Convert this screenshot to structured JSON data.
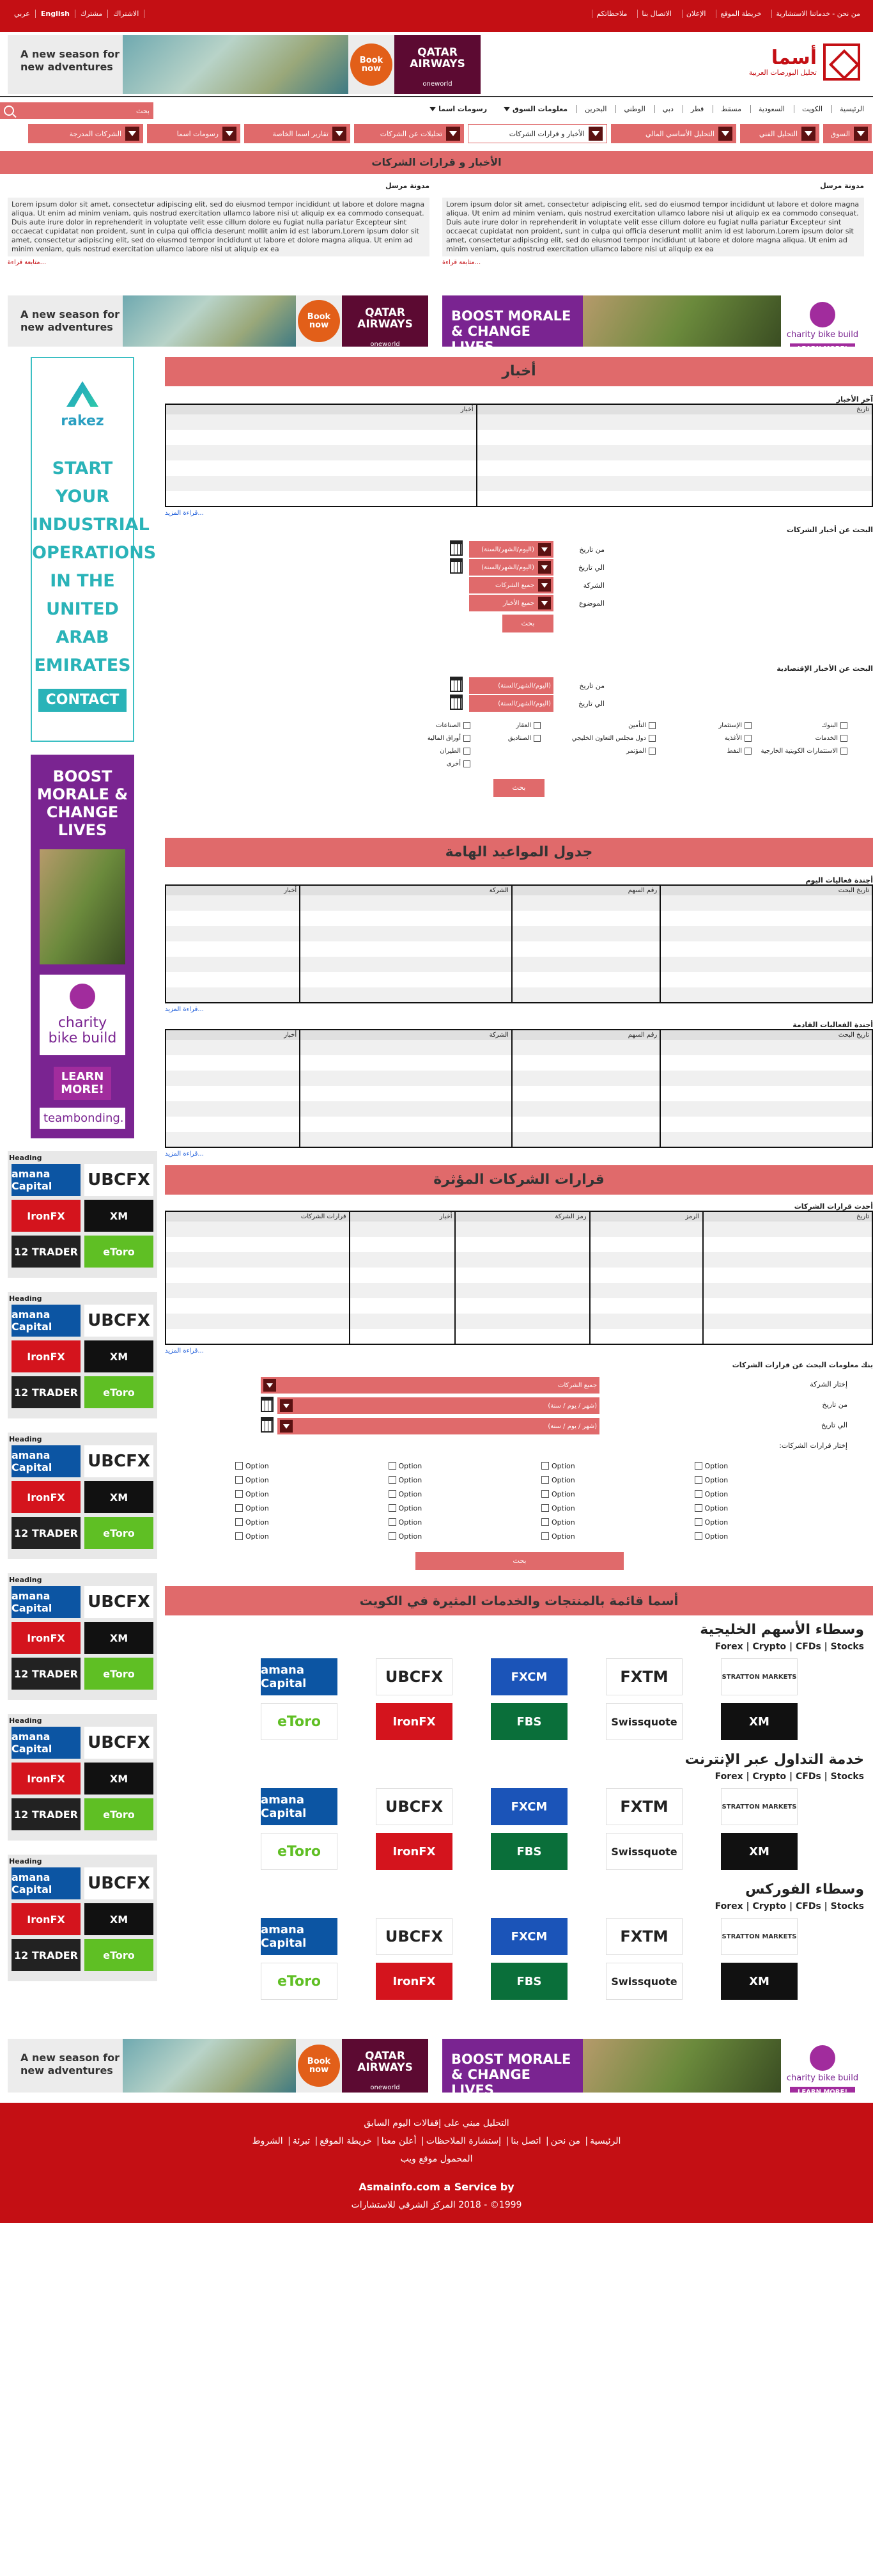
{
  "topbar": {
    "links": [
      "من نحن - خدماتنا الاستشارية",
      "خريطة الموقع",
      "الإعلان",
      "الاتصال بنا",
      "ملاحظاتكم"
    ],
    "lang": [
      "الاشتراك",
      "مشترك",
      "English",
      "عربي"
    ]
  },
  "logo": {
    "title": "أسما",
    "subtitle": "تحليل البورصات العربية"
  },
  "ads": {
    "qatar_text": "A new season for new adventures",
    "qatar_book": "Book now",
    "qatar_brand": "QATAR AIRWAYS",
    "qatar_tag": "oneworld",
    "boost": "BOOST MORALE & CHANGE LIVES",
    "charity": "charity bike build",
    "learn_more": "LEARN MORE!",
    "teambonding": "teambonding.",
    "rakez_name": "rakez",
    "rakez_text": "START YOUR INDUSTRIAL OPERATIONS IN THE UNITED ARAB EMIRATES",
    "rakez_button": "CONTACT US"
  },
  "nav": {
    "items": [
      "الرئيسية",
      "الكويت",
      "السعودية",
      "مسقط",
      "قطر",
      "دبي",
      "الوطني",
      "البحرين"
    ],
    "market_info": "معلومات السوق",
    "asma_charts": "رسومات اسما",
    "search_placeholder": "بحث"
  },
  "catnav": [
    "السوق",
    "التحليل الفني",
    "التحليل الأساسي المالي",
    "الأخبار و قرارات الشركات",
    "تحليلات عن الشركات",
    "تقارير اسما الخاصة",
    "رسومات اسما",
    "الشركات المدرجة"
  ],
  "page_title": "الأخبار و قرارات الشركات",
  "blogs": [
    {
      "title": "مدونة مرسل",
      "text": "Lorem ipsum dolor sit amet, consectetur adipiscing elit, sed do eiusmod tempor incididunt ut labore et dolore magna aliqua. Ut enim ad minim veniam, quis nostrud exercitation ullamco labore nisi ut aliquip ex ea commodo consequat. Duis aute irure dolor in reprehenderit in voluptate velit esse cillum dolore eu fugiat nulla pariatur Excepteur sint occaecat cupidatat non proident, sunt in culpa qui officia deserunt mollit anim id est laborum.Lorem ipsum dolor sit amet, consectetur adipiscing elit, sed do eiusmod tempor incididunt ut labore et dolore magna aliqua. Ut enim ad minim veniam, quis nostrud exercitation ullamco labore nisi ut aliquip ex ea",
      "more": "متابعة قراءة..."
    },
    {
      "title": "مدونة مرسل",
      "text": "Lorem ipsum dolor sit amet, consectetur adipiscing elit, sed do eiusmod tempor incididunt ut labore et dolore magna aliqua. Ut enim ad minim veniam, quis nostrud exercitation ullamco labore nisi ut aliquip ex ea commodo consequat. Duis aute irure dolor in reprehenderit in voluptate velit esse cillum dolore eu fugiat nulla pariatur Excepteur sint occaecat cupidatat non proident, sunt in culpa qui officia deserunt mollit anim id est laborum.Lorem ipsum dolor sit amet, consectetur adipiscing elit, sed do eiusmod tempor incididunt ut labore et dolore magna aliqua. Ut enim ad minim veniam, quis nostrud exercitation ullamco labore nisi ut aliquip ex ea",
      "more": "متابعة قراءة..."
    }
  ],
  "news": {
    "heading": "أخبار",
    "latest": "آخر الأخبار",
    "cols": [
      "تاريخ",
      "أخبار"
    ],
    "more": "قراءة المزيد...",
    "search_company_news": "البحث عن أخبار الشركات",
    "from": "من تاريخ",
    "to": "الي تاريخ",
    "company": "الشركة",
    "subject": "الموضوع",
    "date_placeholder": "(اليوم/الشهر/السنة)",
    "all_companies": "جميع الشركات",
    "all_news": "جميع الأخبار",
    "search_btn": "بحث",
    "search_econ_news": "البحث عن الأخبار الإقتصادية",
    "sectors": [
      "البنوك",
      "الإستثمار",
      "التأمين",
      "العقار",
      "الصناعات",
      "الخدمات",
      "الأغذية",
      "دول مجلس التعاون الخليجي",
      "الصناديق",
      "أوراق المالية",
      "الاستثمارات الكويتية الخارجية",
      "النفط",
      "المؤتمر",
      "الطيران",
      "أخرى"
    ]
  },
  "agenda": {
    "heading": "جدول المواعيد الهامة",
    "today": "أجندة فعاليات اليوم",
    "upcoming": "أجندة الفعاليات القادمة",
    "cols": [
      "تاريخ البحث",
      "رقم السهم",
      "الشركة",
      "أخبار"
    ],
    "more": "قراءة المزيد..."
  },
  "decisions": {
    "heading": "قرارات الشركات المؤثرة",
    "latest": "أحدث قرارات الشركات",
    "cols": [
      "تاريخ",
      "الرمز",
      "رمز الشركة",
      "أخبار",
      "قرارات الشركات"
    ],
    "more": "قراءة المزيد...",
    "search_title": "بنك معلومات البحث عن قرارات الشركات",
    "choose_company": "إختار الشركة",
    "from": "من تاريخ",
    "to": "الي تاريخ",
    "choose_decisions": "إختار قرارات الشركات:",
    "all_companies": "جميع الشركات",
    "date_placeholder": "(شهر / يوم / سنة)",
    "option": "Option",
    "search_btn": "بحث"
  },
  "brokers": {
    "heading": "أسما قائمة بالمنتجات والخدمات المثيرة في الكويت",
    "tags": "Forex | Crypto | CFDs | Stocks",
    "groups": [
      "وسطاء الأسهم الخليجية",
      "خدمة التداول عبر الإنترنت",
      "وسطاء الفوركس"
    ],
    "logos": [
      "STRATTON MARKETS",
      "FXTM",
      "FXCM",
      "UBCFX",
      "amana Capital",
      "XM",
      "Swissquote",
      "FBS",
      "IronFX",
      "eToro"
    ],
    "side_heading": "Heading",
    "side_logos": [
      "amana Capital",
      "UBCFX",
      "IronFX",
      "XM",
      "12 TRADER",
      "eToro"
    ]
  },
  "footer": {
    "line1": "التحليل مبني على إقفالات اليوم السابق",
    "links": [
      "الرئيسية",
      "من نحن",
      "اتصل بنا",
      "إستشارة الملاحظات",
      "أعلن معنا",
      "خريطة الموقع",
      "تبرئة",
      "الشروط"
    ],
    "line3": "المحمول موقع ويب",
    "brand": "Asmainfo.com a Service by",
    "copy": "1999© - 2018  المركز الشرقي للاستشارات"
  }
}
